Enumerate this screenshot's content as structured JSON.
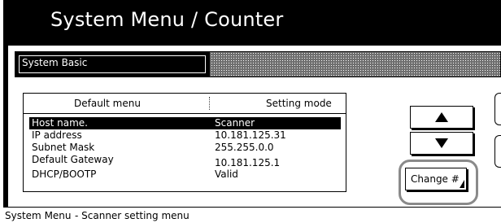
{
  "header": {
    "title": "System Menu / Counter"
  },
  "subheader": {
    "tab_label": "System Basic"
  },
  "table": {
    "columns": [
      "Default menu",
      "Setting mode"
    ],
    "rows": [
      {
        "menu": "Host name.",
        "value": "Scanner",
        "selected": true
      },
      {
        "menu": "IP address",
        "value": "10.181.125.31",
        "selected": false
      },
      {
        "menu": "Subnet Mask",
        "value": "255.255.0.0",
        "selected": false
      },
      {
        "menu": "Default Gateway",
        "value": "10.181.125.1",
        "selected": false
      },
      {
        "menu": "DHCP/BOOTP",
        "value": "Valid",
        "selected": false
      }
    ]
  },
  "buttons": {
    "up_icon": "up-triangle",
    "down_icon": "down-triangle",
    "change_label": "Change #"
  },
  "status": {
    "left": "System Menu",
    "right": "- Scanner setting menu"
  },
  "colors": {
    "background": "#000000",
    "panel": "#ffffff",
    "highlight_ring": "#8a8a8a"
  }
}
